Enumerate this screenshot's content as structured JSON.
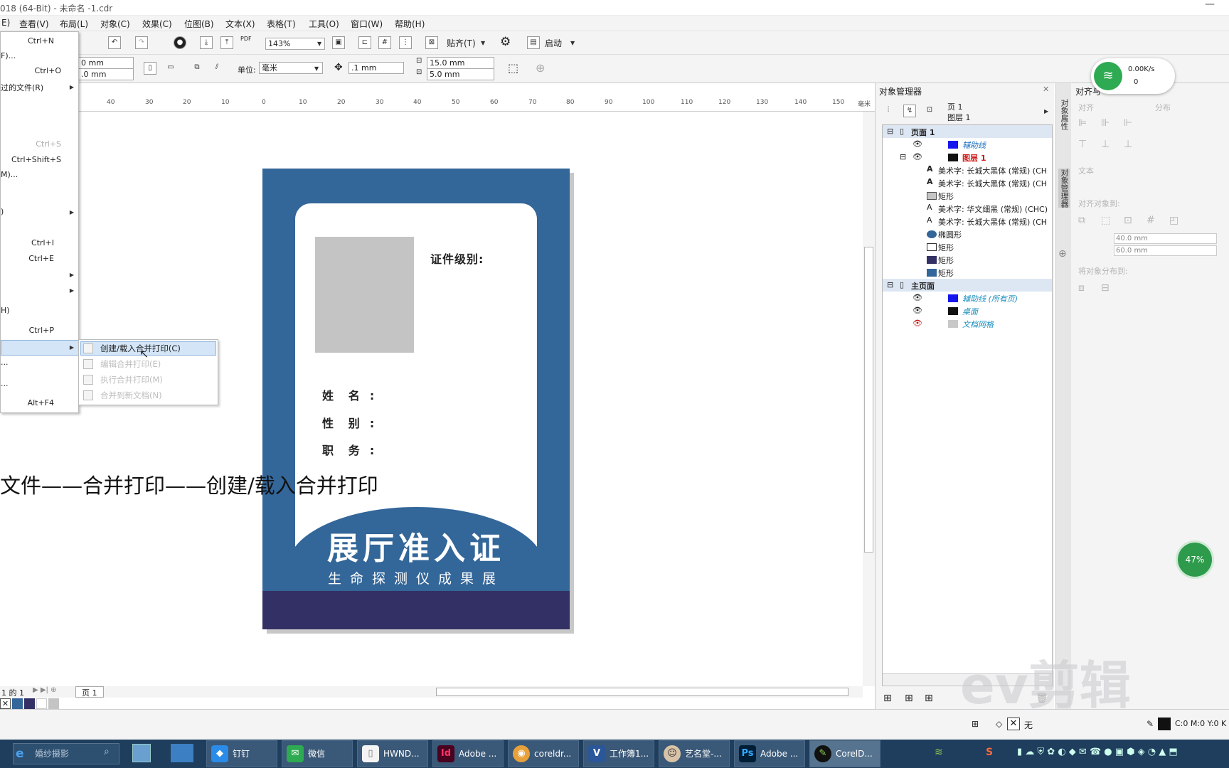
{
  "window": {
    "title": "018 (64-Bit) - 未命名 -1.cdr"
  },
  "menu": [
    "E)",
    "查看(V)",
    "布局(L)",
    "对象(C)",
    "效果(C)",
    "位图(B)",
    "文本(X)",
    "表格(T)",
    "工具(O)",
    "窗口(W)",
    "帮助(H)"
  ],
  "toolbar": {
    "zoom": "143%",
    "snap_label": "贴齐(T)",
    "launch_label": "启动",
    "unit_label": "单位:",
    "unit_value": "毫米",
    "nudge": ".1 mm",
    "dup_x": "15.0 mm",
    "dup_y": "5.0 mm",
    "width": "0 mm",
    "height": ".0 mm"
  },
  "file_menu": {
    "items": [
      {
        "label": "",
        "shortcut": "Ctrl+N"
      },
      {
        "label": "F)...",
        "shortcut": ""
      },
      {
        "label": "",
        "shortcut": "Ctrl+O"
      },
      {
        "label": "过的文件(R)",
        "shortcut": ""
      },
      {
        "label": "",
        "shortcut": "Ctrl+S"
      },
      {
        "label": "",
        "shortcut": "Ctrl+Shift+S"
      },
      {
        "label": "M)...",
        "shortcut": ""
      },
      {
        "label": ")",
        "shortcut": ""
      },
      {
        "label": "",
        "shortcut": "Ctrl+I"
      },
      {
        "label": "",
        "shortcut": "Ctrl+E"
      },
      {
        "label": "H)",
        "shortcut": ""
      },
      {
        "label": "",
        "shortcut": "Ctrl+P"
      },
      {
        "label": "",
        "shortcut": ""
      },
      {
        "label": "...",
        "shortcut": ""
      },
      {
        "label": "...",
        "shortcut": ""
      },
      {
        "label": "",
        "shortcut": "Alt+F4"
      }
    ]
  },
  "merge_submenu": [
    "创建/载入合并打印(C)",
    "编辑合并打印(E)",
    "执行合并打印(M)",
    "合并到新文档(N)"
  ],
  "card": {
    "level_label": "证件级别:",
    "name_label": "姓   名  :",
    "gender_label": "性   别  :",
    "role_label": "职   务  :",
    "title": "展厅准入证",
    "subtitle": "生命探测仪成果展"
  },
  "caption": "文件——合并打印——创建/载入合并打印",
  "ruler_ticks": [
    "40",
    "30",
    "20",
    "10",
    "0",
    "10",
    "20",
    "30",
    "40",
    "50",
    "60",
    "70",
    "80",
    "90",
    "100",
    "110",
    "120",
    "130",
    "140",
    "150",
    "毫米"
  ],
  "page_nav": {
    "count": "1 的 1",
    "tab": "页 1"
  },
  "object_manager": {
    "title": "对象管理器",
    "page": "页 1",
    "layer": "图层 1",
    "rows": [
      {
        "text": "页面 1",
        "type": "header",
        "color": ""
      },
      {
        "text": "辅助线",
        "type": "layer",
        "color": "#1515ee"
      },
      {
        "text": "图层 1",
        "type": "layer-active",
        "color": "#111111"
      },
      {
        "text": "美术字: 长城大黑体 (常规) (CH",
        "type": "obj",
        "color": ""
      },
      {
        "text": "美术字: 长城大黑体 (常规) (CH",
        "type": "obj",
        "color": ""
      },
      {
        "text": "矩形",
        "type": "obj",
        "color": "#c4c4c4"
      },
      {
        "text": "美术字: 华文细黑 (常规) (CHC)",
        "type": "obj",
        "color": ""
      },
      {
        "text": "美术字: 长城大黑体 (常规) (CH",
        "type": "obj",
        "color": ""
      },
      {
        "text": "椭圆形",
        "type": "obj",
        "color": "#336699"
      },
      {
        "text": "矩形",
        "type": "obj",
        "color": "#ffffff"
      },
      {
        "text": "矩形",
        "type": "obj",
        "color": "#323064"
      },
      {
        "text": "矩形",
        "type": "obj",
        "color": "#336699"
      },
      {
        "text": "主页面",
        "type": "header",
        "color": ""
      },
      {
        "text": "辅助线 (所有页)",
        "type": "master",
        "color": "#1515ee"
      },
      {
        "text": "桌面",
        "type": "master",
        "color": "#111111"
      },
      {
        "text": "文档网格",
        "type": "master",
        "color": "#c8c8c8"
      }
    ]
  },
  "side_tabs": [
    "对象属性",
    "对象管理器"
  ],
  "align_panel": {
    "title": "对齐与",
    "align_label": "对齐",
    "distribute_label": "分布",
    "text_label": "文本",
    "align_to_label": "对齐对象到:",
    "x": "40.0 mm",
    "y": "60.0 mm",
    "distribute_to_label": "将对象分布到:"
  },
  "network": {
    "speed": "0.00K/s",
    "count": "0"
  },
  "progress_percent": "47%",
  "status": {
    "fill": "无",
    "cmyk": "C:0 M:0 Y:0 K"
  },
  "watermark": "ev剪辑",
  "taskbar": {
    "search": "婚纱摄影",
    "apps": [
      {
        "label": "钉钉",
        "icon": "dingtalk-icon"
      },
      {
        "label": "微信",
        "icon": "wechat-icon"
      },
      {
        "label": "HWND...",
        "icon": "file-icon"
      },
      {
        "label": "Adobe ...",
        "icon": "indesign-icon"
      },
      {
        "label": "coreldr...",
        "icon": "corel-icon"
      },
      {
        "label": "工作簿1...",
        "icon": "excel-icon"
      },
      {
        "label": "艺名堂-...",
        "icon": "avatar-icon"
      },
      {
        "label": "Adobe ...",
        "icon": "photoshop-icon"
      },
      {
        "label": "CorelD...",
        "icon": "coreldraw-icon"
      }
    ]
  },
  "colors": {
    "card_blue": "#336699",
    "card_navy": "#323064",
    "photo_gray": "#c4c4c4"
  }
}
